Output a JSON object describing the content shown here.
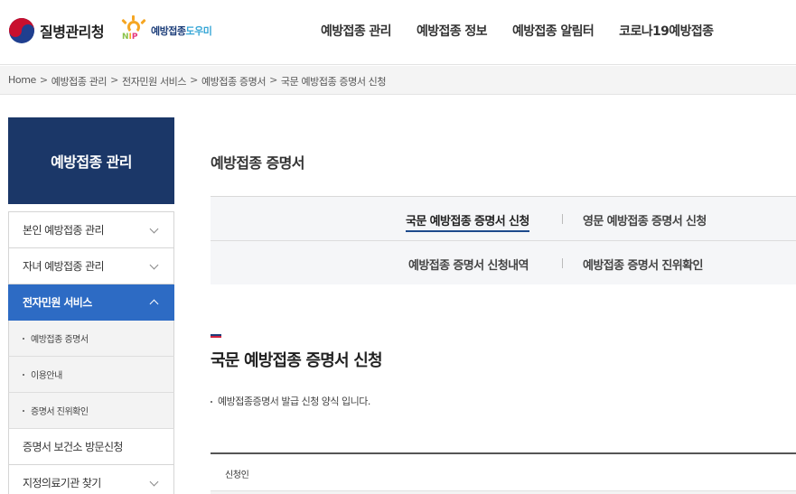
{
  "header": {
    "org_name": "질병관리청",
    "nip_logo_mark": "NIP",
    "nip_logo_text_a": "예방접종",
    "nip_logo_text_b": "도우미",
    "nav": [
      "예방접종 관리",
      "예방접종 정보",
      "예방접종 알림터",
      "코로나19예방접종"
    ]
  },
  "breadcrumb": [
    "Home",
    "예방접종 관리",
    "전자민원 서비스",
    "예방접종 증명서",
    "국문 예방접종 증명서 신청"
  ],
  "breadcrumb_sep": ">",
  "sidebar": {
    "title": "예방접종 관리",
    "items": [
      {
        "label": "본인 예방접종 관리"
      },
      {
        "label": "자녀 예방접종 관리"
      },
      {
        "label": "전자민원 서비스"
      },
      {
        "label": "예방접종 증명서"
      },
      {
        "label": "이용안내"
      },
      {
        "label": "증명서 진위확인"
      },
      {
        "label": "증명서 보건소 방문신청"
      },
      {
        "label": "지정의료기관 찾기"
      }
    ]
  },
  "content": {
    "page_title": "예방접종 증명서",
    "tabs": [
      {
        "label": "국문 예방접종 증명서 신청"
      },
      {
        "label": "영문 예방접종 증명서 신청"
      },
      {
        "label": "예방접종 증명서 신청내역"
      },
      {
        "label": "예방접종 증명서 진위확인"
      }
    ],
    "section_title": "국문 예방접종 증명서 신청",
    "section_desc": "예방접종증명서 발급 신청 양식 입니다.",
    "table_header": "신청인"
  },
  "colors": {
    "sidebar_title_bg": "#1b3768",
    "sidebar_active_bg": "#2d6bc4",
    "tab_underline": "#1d4a8c"
  }
}
